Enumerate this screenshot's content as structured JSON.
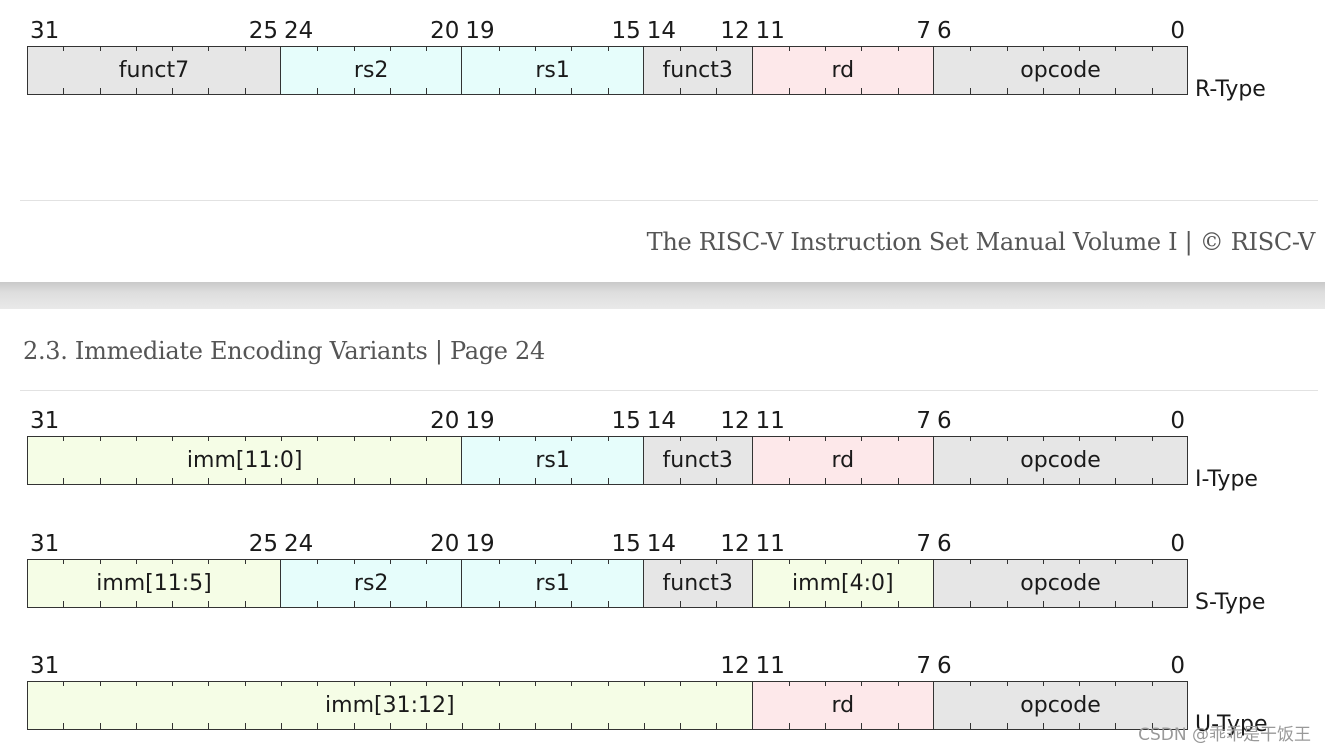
{
  "colors": {
    "gray": "#e6e6e6",
    "cyan": "#e6fdfb",
    "pink": "#fde8ea",
    "yellow": "#f5fde6"
  },
  "footer": {
    "text": "The RISC-V Instruction Set Manual Volume I | © RISC-V"
  },
  "header": {
    "text": "2.3. Immediate Encoding Variants | Page 24"
  },
  "diagrams": [
    {
      "type_label": "R-Type",
      "fields": [
        {
          "label": "funct7",
          "hi": 31,
          "lo": 25,
          "color": "gray"
        },
        {
          "label": "rs2",
          "hi": 24,
          "lo": 20,
          "color": "cyan"
        },
        {
          "label": "rs1",
          "hi": 19,
          "lo": 15,
          "color": "cyan"
        },
        {
          "label": "funct3",
          "hi": 14,
          "lo": 12,
          "color": "gray"
        },
        {
          "label": "rd",
          "hi": 11,
          "lo": 7,
          "color": "pink"
        },
        {
          "label": "opcode",
          "hi": 6,
          "lo": 0,
          "color": "gray"
        }
      ]
    },
    {
      "type_label": "I-Type",
      "fields": [
        {
          "label": "imm[11:0]",
          "hi": 31,
          "lo": 20,
          "color": "yellow"
        },
        {
          "label": "rs1",
          "hi": 19,
          "lo": 15,
          "color": "cyan"
        },
        {
          "label": "funct3",
          "hi": 14,
          "lo": 12,
          "color": "gray"
        },
        {
          "label": "rd",
          "hi": 11,
          "lo": 7,
          "color": "pink"
        },
        {
          "label": "opcode",
          "hi": 6,
          "lo": 0,
          "color": "gray"
        }
      ]
    },
    {
      "type_label": "S-Type",
      "fields": [
        {
          "label": "imm[11:5]",
          "hi": 31,
          "lo": 25,
          "color": "yellow"
        },
        {
          "label": "rs2",
          "hi": 24,
          "lo": 20,
          "color": "cyan"
        },
        {
          "label": "rs1",
          "hi": 19,
          "lo": 15,
          "color": "cyan"
        },
        {
          "label": "funct3",
          "hi": 14,
          "lo": 12,
          "color": "gray"
        },
        {
          "label": "imm[4:0]",
          "hi": 11,
          "lo": 7,
          "color": "yellow"
        },
        {
          "label": "opcode",
          "hi": 6,
          "lo": 0,
          "color": "gray"
        }
      ]
    },
    {
      "type_label": "U-Type",
      "fields": [
        {
          "label": "imm[31:12]",
          "hi": 31,
          "lo": 12,
          "color": "yellow"
        },
        {
          "label": "rd",
          "hi": 11,
          "lo": 7,
          "color": "pink"
        },
        {
          "label": "opcode",
          "hi": 6,
          "lo": 0,
          "color": "gray"
        }
      ]
    }
  ],
  "watermark": {
    "text": "CSDN @乖乖是干饭王"
  }
}
